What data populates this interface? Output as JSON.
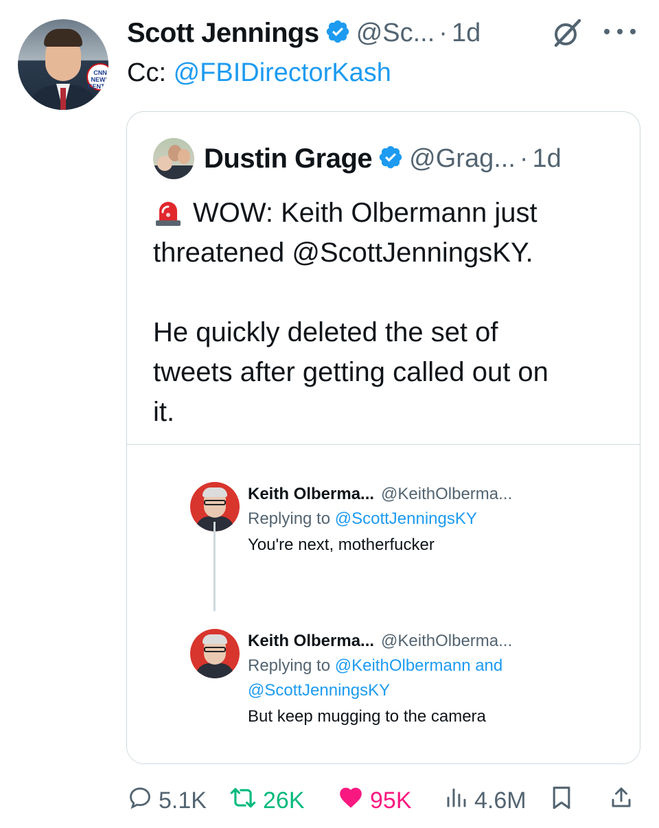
{
  "author": {
    "name": "Scott Jennings",
    "handle": "@Sc...",
    "time": "1d",
    "avatar_badge": "CNN NEWS CENTRAL"
  },
  "tweet": {
    "prefix": "Cc: ",
    "mention": "@FBIDirectorKash"
  },
  "quoted": {
    "name": "Dustin Grage",
    "handle": "@Grag...",
    "time": "1d",
    "lines": [
      "WOW: Keith Olbermann just",
      "threatened @ScottJenningsKY.",
      "",
      "He quickly deleted the set of",
      "tweets after getting called out on",
      "it."
    ],
    "embedded_tweets": [
      {
        "name": "Keith Olberma...",
        "handle": "@KeithOlberma...",
        "reply_prefix": "Replying to ",
        "reply_mentions_line1": "@ScottJenningsKY",
        "reply_mentions_line2": "",
        "text": "You're next, motherfucker"
      },
      {
        "name": "Keith Olberma...",
        "handle": "@KeithOlberma...",
        "reply_prefix": "Replying to ",
        "reply_mentions_line1": "@KeithOlbermann and",
        "reply_mentions_line2": "@ScottJenningsKY",
        "text": "But keep mugging to the camera"
      }
    ]
  },
  "stats": {
    "replies": "5.1K",
    "reposts": "26K",
    "likes": "95K",
    "views": "4.6M"
  },
  "colors": {
    "accent": "#1d9bf0",
    "repost": "#00ba7c",
    "like": "#f91880",
    "muted": "#536471",
    "border": "#cfd9de"
  },
  "icons": [
    "verified-badge-icon",
    "grok-icon",
    "more-icon",
    "siren-icon",
    "reply-icon",
    "repost-icon",
    "like-icon",
    "views-icon",
    "bookmark-icon",
    "share-icon"
  ]
}
